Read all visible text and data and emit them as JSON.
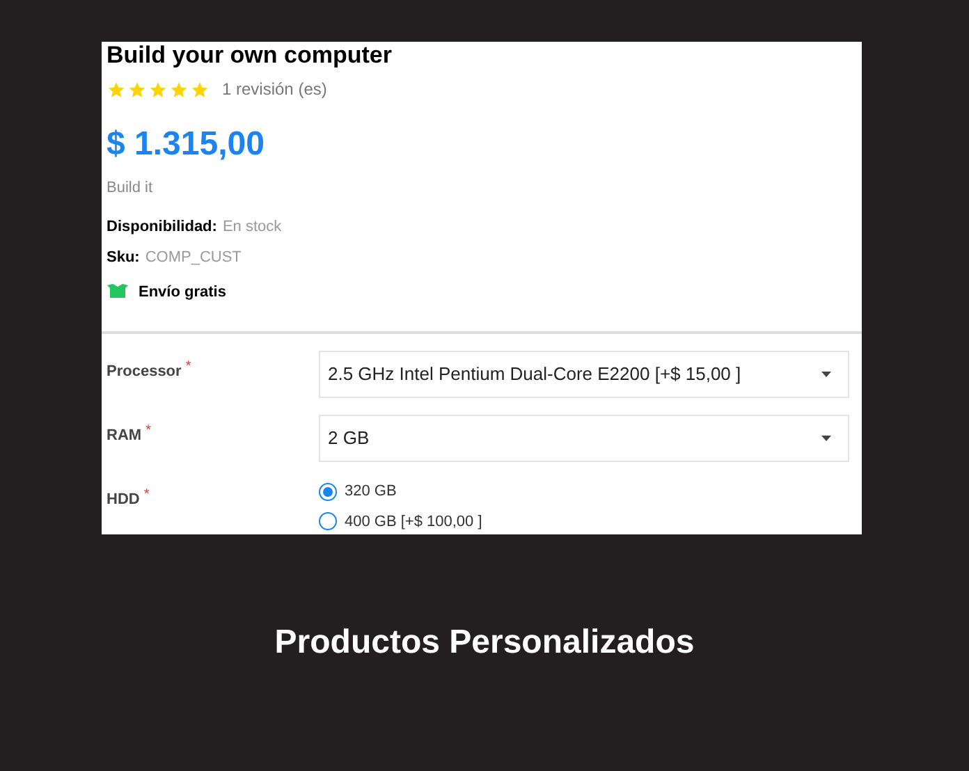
{
  "product": {
    "title": "Build your own computer",
    "stars": 5,
    "reviews": "1 revisión (es)",
    "price": "$ 1.315,00",
    "short_description": "Build it",
    "availability": {
      "label": "Disponibilidad:",
      "value": "En stock"
    },
    "sku": {
      "label": "Sku:",
      "value": "COMP_CUST"
    },
    "shipping": "Envío gratis"
  },
  "attributes": [
    {
      "kind": "select",
      "label": "Processor",
      "required_mark": "*",
      "value": "2.5 GHz Intel Pentium Dual-Core E2200 [+$ 15,00 ]"
    },
    {
      "kind": "select",
      "label": "RAM",
      "required_mark": "*",
      "value": "2 GB"
    },
    {
      "kind": "radio",
      "label": "HDD",
      "required_mark": "*",
      "options": [
        {
          "label": "320 GB",
          "selected": true
        },
        {
          "label": "400 GB [+$ 100,00 ]",
          "selected": false
        }
      ]
    }
  ],
  "caption": "Productos Personalizados"
}
